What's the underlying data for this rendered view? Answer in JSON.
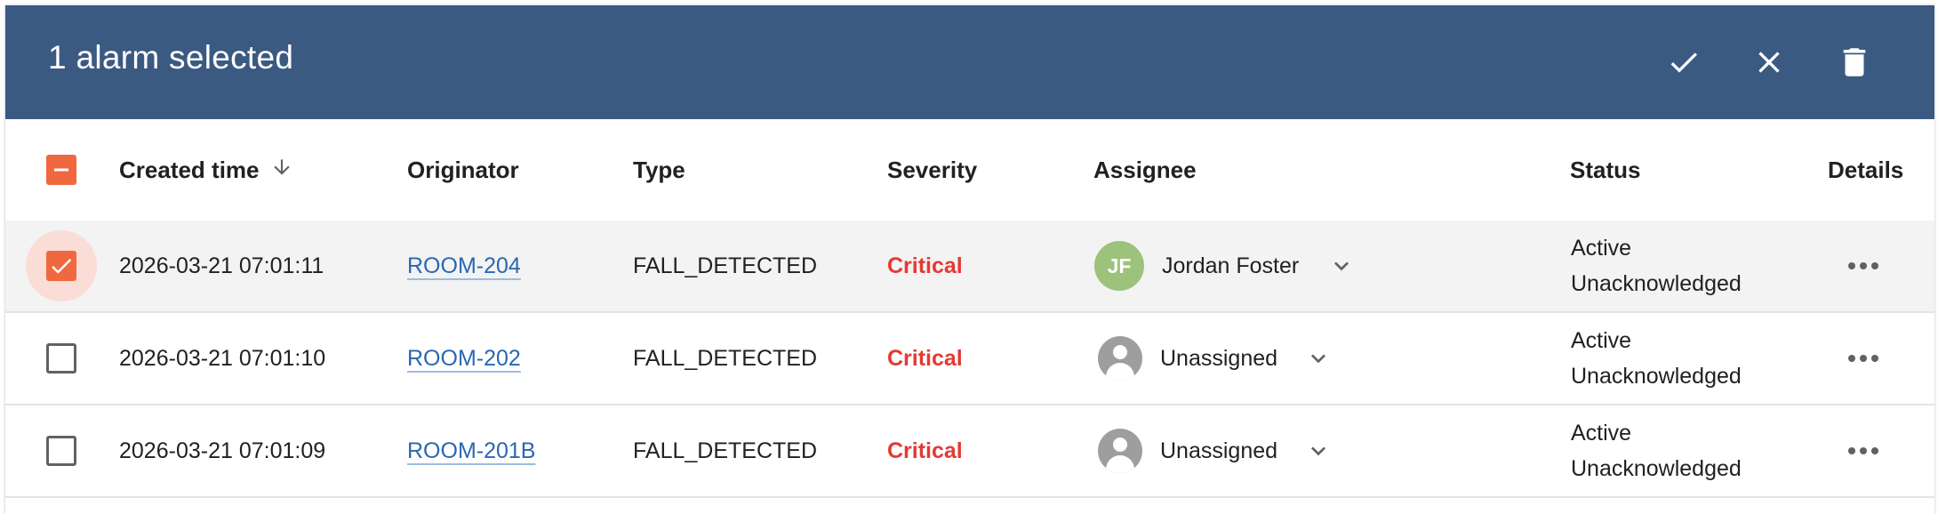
{
  "toolbar": {
    "title": "1 alarm selected",
    "actions": [
      {
        "name": "acknowledge",
        "icon": "check-icon"
      },
      {
        "name": "clear",
        "icon": "close-icon"
      },
      {
        "name": "delete",
        "icon": "delete-icon"
      }
    ]
  },
  "table": {
    "columns": {
      "created_time": "Created time",
      "originator": "Originator",
      "type": "Type",
      "severity": "Severity",
      "assignee": "Assignee",
      "status": "Status",
      "details": "Details"
    },
    "sort": {
      "column": "created_time",
      "direction": "descending"
    },
    "header_checkbox": "indeterminate",
    "rows": [
      {
        "selected": true,
        "created_time": "2026-03-21 07:01:11",
        "originator": "ROOM-204",
        "type": "FALL_DETECTED",
        "severity": "Critical",
        "assignee": {
          "initials": "JF",
          "name": "Jordan Foster"
        },
        "status_line1": "Active",
        "status_line2": "Unacknowledged"
      },
      {
        "selected": false,
        "created_time": "2026-03-21 07:01:10",
        "originator": "ROOM-202",
        "type": "FALL_DETECTED",
        "severity": "Critical",
        "assignee": {
          "initials": "",
          "name": "Unassigned"
        },
        "status_line1": "Active",
        "status_line2": "Unacknowledged"
      },
      {
        "selected": false,
        "created_time": "2026-03-21 07:01:09",
        "originator": "ROOM-201B",
        "type": "FALL_DETECTED",
        "severity": "Critical",
        "assignee": {
          "initials": "",
          "name": "Unassigned"
        },
        "status_line1": "Active",
        "status_line2": "Unacknowledged"
      }
    ]
  },
  "colors": {
    "toolbar_bg": "#3b5a82",
    "accent": "#f0683f",
    "critical": "#e53935",
    "link": "#2a67b2",
    "avatar_jf": "#9dc27c"
  }
}
